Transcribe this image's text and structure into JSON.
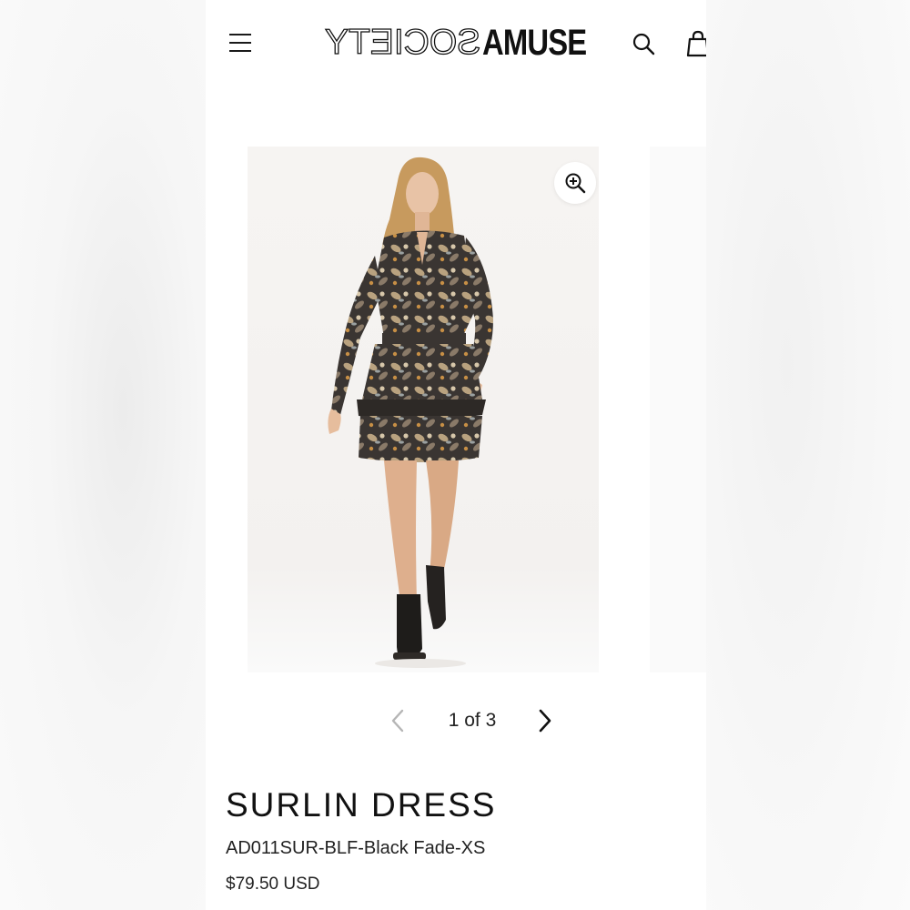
{
  "header": {
    "logo_left": "SOCIETY",
    "logo_right": "AMUSE"
  },
  "gallery": {
    "current": 1,
    "total": 3,
    "counter_text": "1 of 3"
  },
  "product": {
    "title": "SURLIN DRESS",
    "sku": "AD011SUR-BLF-Black Fade-XS",
    "price": "$79.50 USD"
  },
  "icons": {
    "menu": "hamburger-menu-icon",
    "search": "search-icon",
    "cart": "shopping-bag-icon",
    "zoom": "zoom-in-icon",
    "prev": "chevron-left-icon",
    "next": "chevron-right-icon"
  },
  "colors": {
    "text": "#111111",
    "pager_disabled": "#b5b5b5",
    "page_background": "#ffffff"
  }
}
